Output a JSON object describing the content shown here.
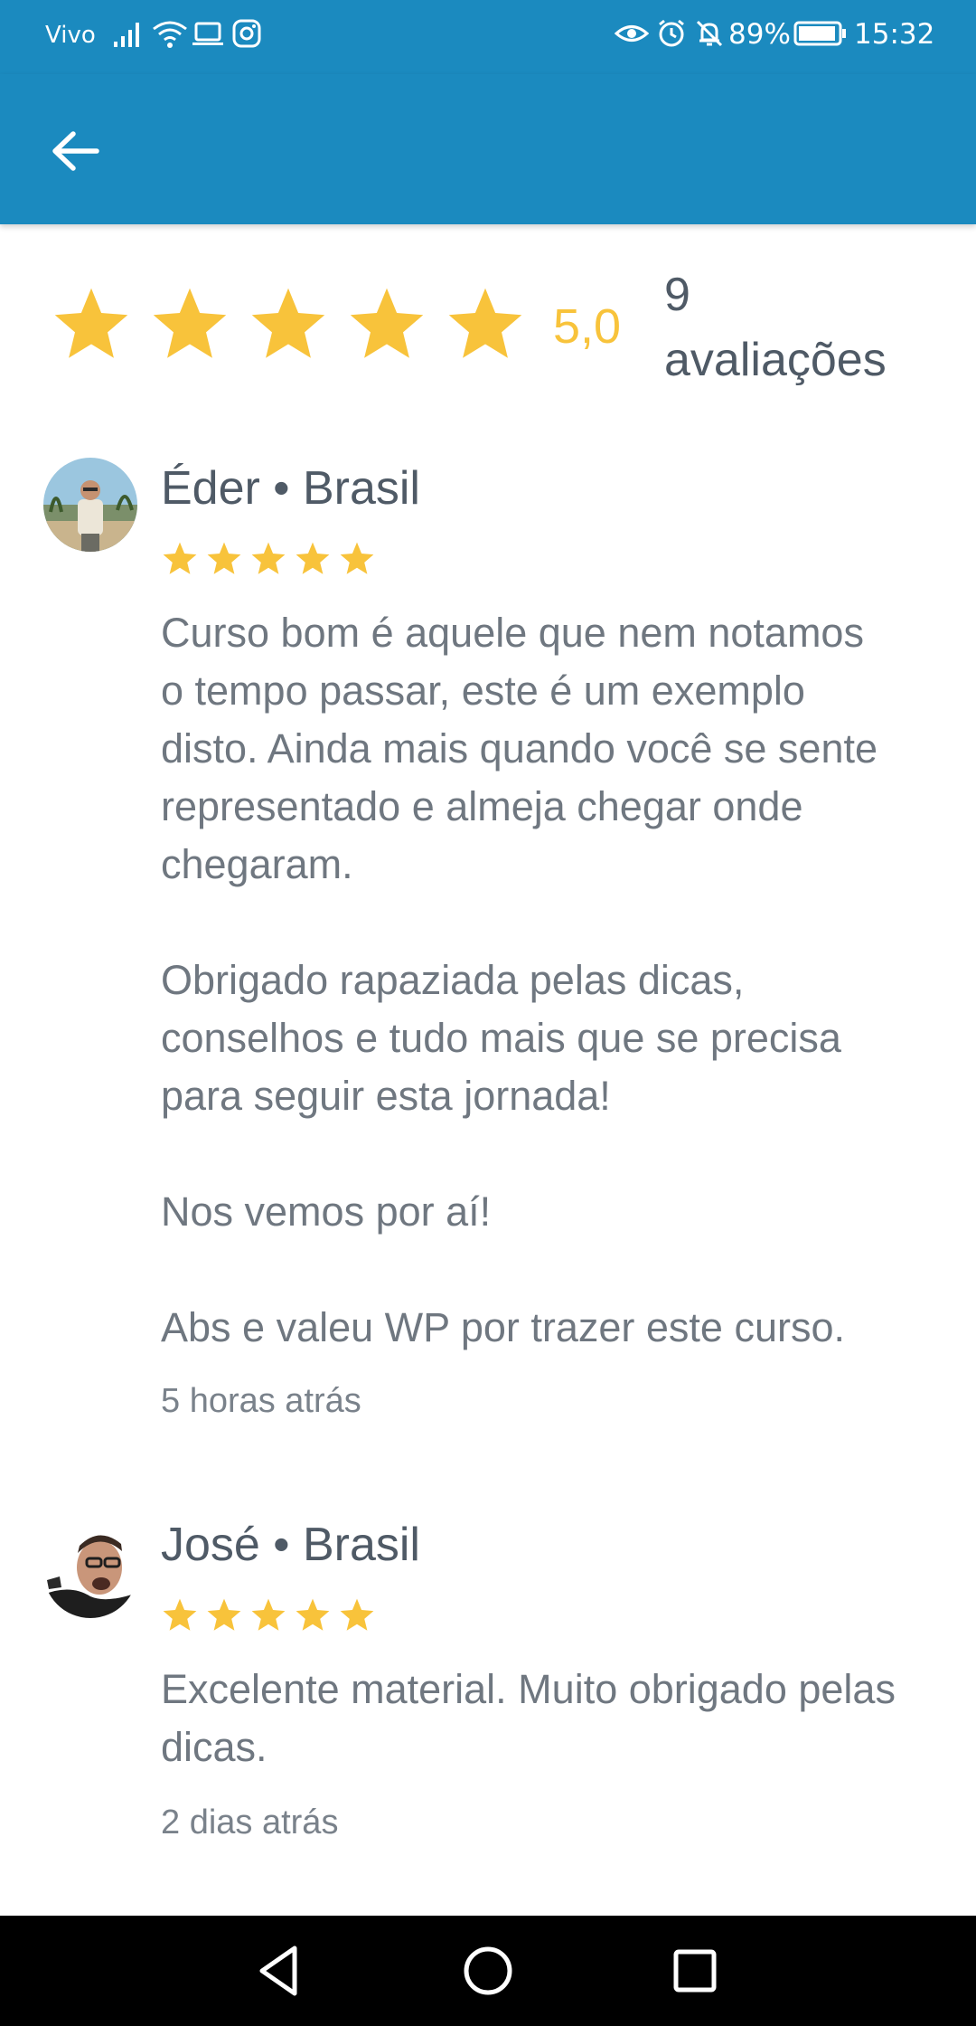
{
  "status_bar": {
    "carrier": "Vivo",
    "battery_percent": "89%",
    "time": "15:32",
    "icons": [
      "signal-icon",
      "wifi-icon",
      "laptop-icon",
      "instagram-icon",
      "eye-icon",
      "alarm-icon",
      "bell-off-icon",
      "battery-icon"
    ]
  },
  "app_bar": {
    "back_icon": "arrow-left-icon"
  },
  "summary": {
    "average": "5,0",
    "stars": 5,
    "count_number": "9",
    "count_label": "avaliações"
  },
  "reviews": [
    {
      "name": "Éder • Brasil",
      "stars": 5,
      "text": "Curso bom é aquele que nem notamos\no tempo passar, este é um exemplo\ndisto. Ainda mais quando você se sente\nrepresentado e almeja chegar onde\nchegaram.\n\nObrigado rapaziada pelas dicas,\nconselhos e tudo mais que se precisa\npara seguir esta jornada!\n\nNos vemos por aí!\n\nAbs e valeu WP por trazer este curso.",
      "time": "5 horas atrás"
    },
    {
      "name": "José • Brasil",
      "stars": 5,
      "text": "Excelente material.  Muito obrigado pelas\ndicas.",
      "time": "2 dias atrás"
    }
  ],
  "colors": {
    "primary": "#1b8abf",
    "star": "#f8c33b",
    "name_text": "#4f5a66",
    "body_text": "#6f7780"
  },
  "nav_bar": {
    "icons": [
      "back-triangle-icon",
      "home-circle-icon",
      "recents-square-icon"
    ]
  }
}
